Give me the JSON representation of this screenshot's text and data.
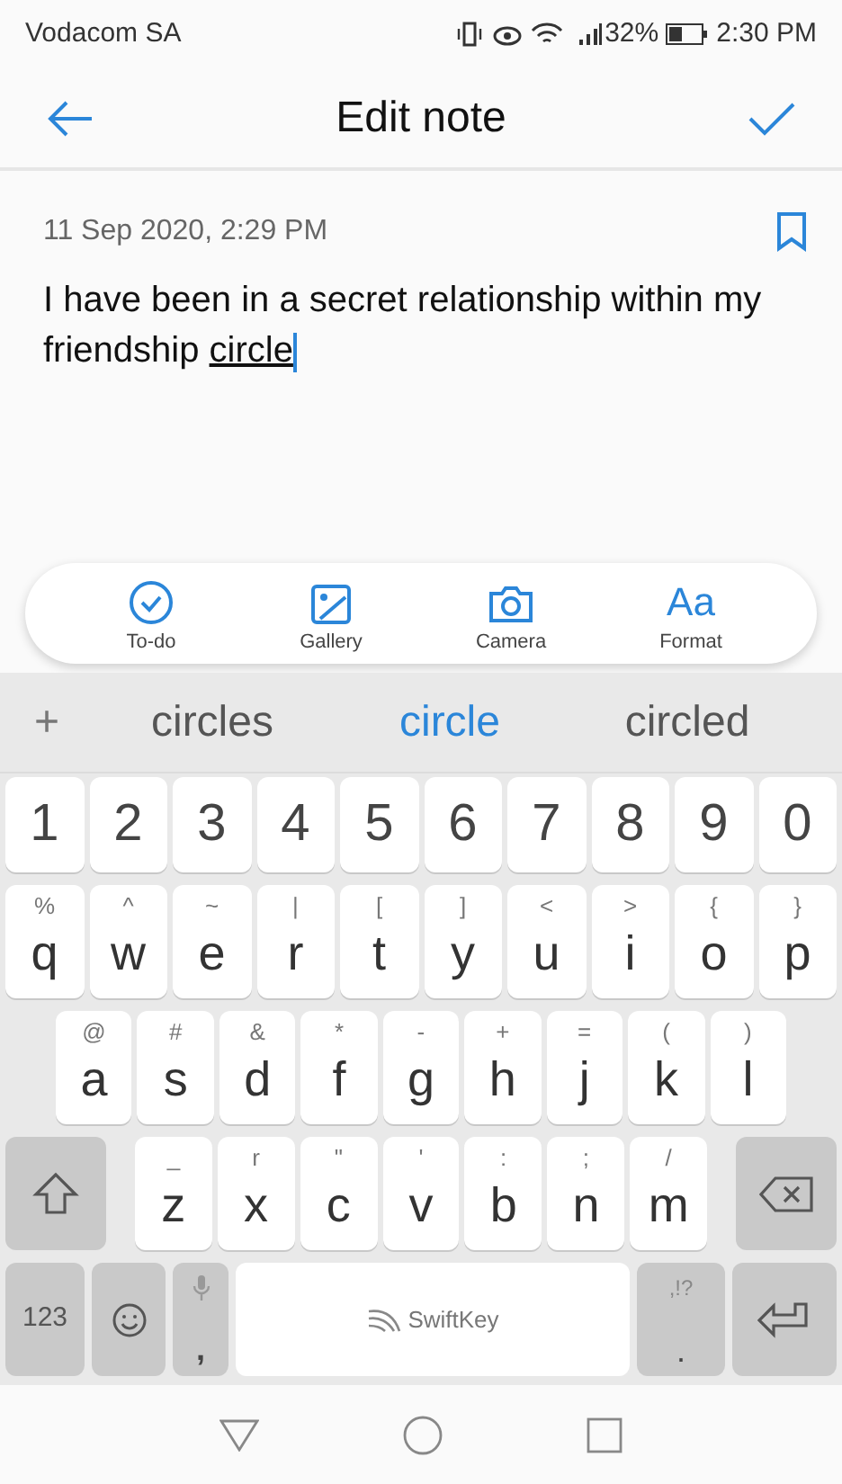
{
  "status_bar": {
    "carrier": "Vodacom SA",
    "battery": "32%",
    "time": "2:30 PM"
  },
  "header": {
    "title": "Edit note"
  },
  "note": {
    "date": "11 Sep 2020, 2:29 PM",
    "text": "I have been in a secret relationship within my friendship ",
    "composing": "circle"
  },
  "toolbar": [
    {
      "kind": "todo",
      "label": "To-do"
    },
    {
      "kind": "gallery",
      "label": "Gallery"
    },
    {
      "kind": "camera",
      "label": "Camera"
    },
    {
      "kind": "format",
      "label": "Format",
      "glyph": "Aa"
    }
  ],
  "suggestions": {
    "add": "+",
    "items": [
      {
        "text": "circles",
        "selected": false
      },
      {
        "text": "circle",
        "selected": true
      },
      {
        "text": "circled",
        "selected": false
      }
    ]
  },
  "keyboard": {
    "number_row": [
      "1",
      "2",
      "3",
      "4",
      "5",
      "6",
      "7",
      "8",
      "9",
      "0"
    ],
    "rows": [
      [
        {
          "main": "q",
          "hint": "%"
        },
        {
          "main": "w",
          "hint": "^"
        },
        {
          "main": "e",
          "hint": "~"
        },
        {
          "main": "r",
          "hint": "|"
        },
        {
          "main": "t",
          "hint": "["
        },
        {
          "main": "y",
          "hint": "]"
        },
        {
          "main": "u",
          "hint": "<"
        },
        {
          "main": "i",
          "hint": ">"
        },
        {
          "main": "o",
          "hint": "{"
        },
        {
          "main": "p",
          "hint": "}"
        }
      ],
      [
        {
          "main": "a",
          "hint": "@"
        },
        {
          "main": "s",
          "hint": "#"
        },
        {
          "main": "d",
          "hint": "&"
        },
        {
          "main": "f",
          "hint": "*"
        },
        {
          "main": "g",
          "hint": "-"
        },
        {
          "main": "h",
          "hint": "+"
        },
        {
          "main": "j",
          "hint": "="
        },
        {
          "main": "k",
          "hint": "("
        },
        {
          "main": "l",
          "hint": ")"
        }
      ],
      [
        {
          "main": "z",
          "hint": "_"
        },
        {
          "main": "x",
          "hint": "r"
        },
        {
          "main": "c",
          "hint": "\""
        },
        {
          "main": "v",
          "hint": "'"
        },
        {
          "main": "b",
          "hint": ":"
        },
        {
          "main": "n",
          "hint": ";"
        },
        {
          "main": "m",
          "hint": "/"
        }
      ]
    ],
    "numbers_key": "123",
    "comma_key": ",",
    "space_label": "SwiftKey",
    "period_key": ".",
    "period_hint": ",!?"
  }
}
